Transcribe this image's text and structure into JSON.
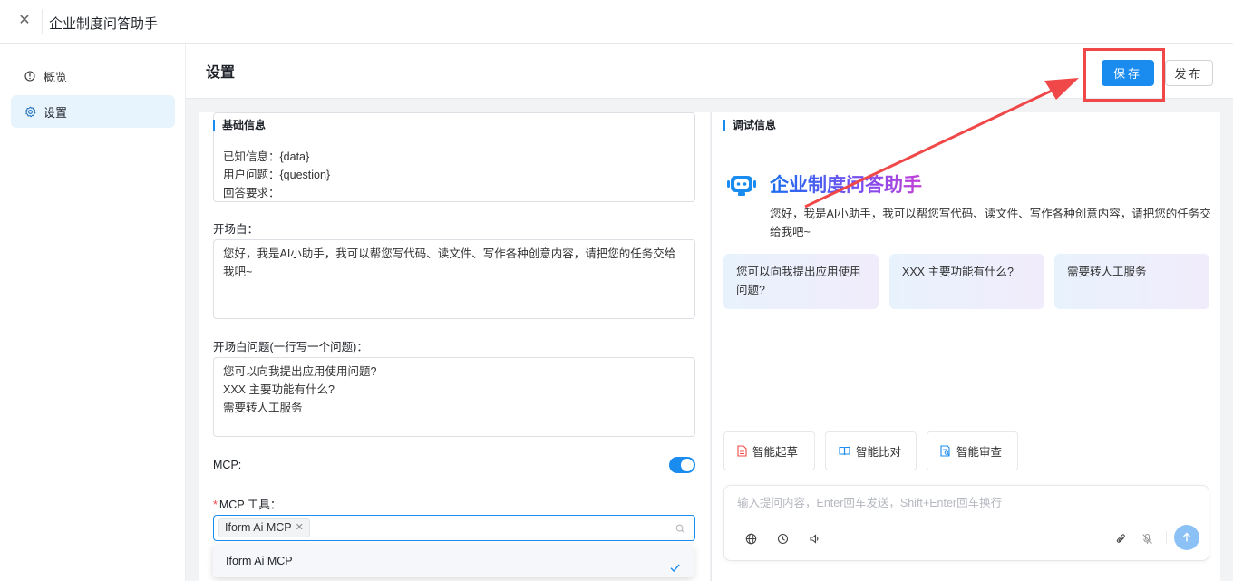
{
  "titlebar": {
    "title": "企业制度问答助手",
    "close_glyph": "✕"
  },
  "sidebar": {
    "items": [
      {
        "label": "概览",
        "icon": "info-circle-icon"
      },
      {
        "label": "设置",
        "icon": "gear-icon",
        "active": true
      }
    ]
  },
  "header": {
    "title": "设置",
    "save_label": "保存",
    "publish_label": "发布"
  },
  "basic": {
    "section_title": "基础信息",
    "prompt_text": "已知信息：{data}\n用户问题：{question}\n回答要求：\n- 请使用中文回答用户问题",
    "opening_label": "开场白：",
    "opening_text": "您好，我是AI小助手，我可以帮您写代码、读文件、写作各种创意内容，请把您的任务交给我吧~",
    "questions_label": "开场白问题(一行写一个问题)：",
    "questions_text": "您可以向我提出应用使用问题?\nXXX 主要功能有什么?\n需要转人工服务",
    "mcp_label": "MCP:",
    "mcp_enabled": true,
    "mcp_tools_required": "*",
    "mcp_tools_label": "MCP 工具：",
    "mcp_tools_selected": [
      "Iform Ai MCP"
    ],
    "mcp_tools_options": [
      {
        "label": "Iform Ai MCP",
        "selected": true
      }
    ]
  },
  "debug": {
    "section_title": "调试信息",
    "bot_name": "企业制度问答助手",
    "greeting": "您好，我是AI小助手，我可以帮您写代码、读文件、写作各种创意内容，请把您的任务交给我吧~",
    "suggestions": [
      "您可以向我提出应用使用问题?",
      "XXX 主要功能有什么?",
      "需要转人工服务"
    ],
    "tools": [
      {
        "label": "智能起草",
        "icon": "document-icon",
        "color": "#f04848"
      },
      {
        "label": "智能比对",
        "icon": "book-icon",
        "color": "#1a8cf0"
      },
      {
        "label": "智能审查",
        "icon": "review-icon",
        "color": "#1a8cf0"
      }
    ],
    "input_placeholder": "输入提问内容，Enter回车发送，Shift+Enter回车换行"
  },
  "colors": {
    "accent": "#1a8cf0",
    "highlight": "#f04848"
  }
}
